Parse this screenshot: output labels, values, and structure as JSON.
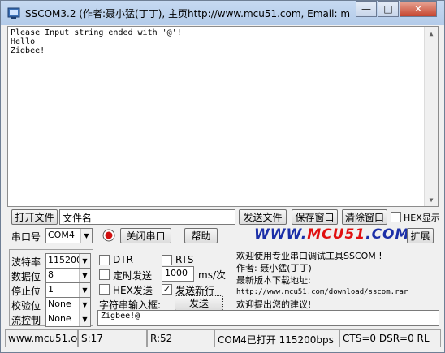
{
  "window": {
    "title": "SSCOM3.2 (作者:聂小猛(丁丁), 主页http://www.mcu51.com,  Email: mc...",
    "minimize": "—",
    "maximize": "□",
    "close": "✕"
  },
  "output": {
    "lines": [
      "Please Input string ended with '@'!",
      "Hello",
      "Zigbee!"
    ]
  },
  "toolbar": {
    "open_file": "打开文件",
    "file_name": "文件名",
    "send_file": "发送文件",
    "save_window": "保存窗口",
    "clear_window": "清除窗口",
    "hex_display": "HEX显示"
  },
  "port_row": {
    "port_label": "串口号",
    "port_value": "COM4",
    "close_port": "关闭串口",
    "help": "帮助",
    "expand": "扩展",
    "logo_prefix": "WWW.",
    "logo_main": "MCU51",
    "logo_suffix": ".COM"
  },
  "settings": {
    "baud_label": "波特率",
    "baud_value": "115200",
    "data_bits_label": "数据位",
    "data_bits_value": "8",
    "stop_bits_label": "停止位",
    "stop_bits_value": "1",
    "parity_label": "校验位",
    "parity_value": "None",
    "flow_label": "流控制",
    "flow_value": "None"
  },
  "options": {
    "dtr": "DTR",
    "rts": "RTS",
    "timed_send": "定时发送",
    "interval_value": "1000",
    "interval_unit": "ms/次",
    "hex_send": "HEX发送",
    "send_newline": "发送新行",
    "input_label": "字符串输入框:",
    "send_button": "发送",
    "send_newline_checked": true
  },
  "info": {
    "line1": "欢迎使用专业串口调试工具SSCOM !",
    "line2": "作者: 聂小猛(丁丁)",
    "line3": "最新版本下载地址:",
    "line4": "http://www.mcu51.com/download/sscom.rar",
    "line5": "欢迎提出您的建议!"
  },
  "input": {
    "value": "Zigbee!@"
  },
  "status": {
    "site": "www.mcu51.cor",
    "sent": "S:17",
    "received": "R:52",
    "port_state": "COM4已打开  115200bps",
    "signals": "CTS=0 DSR=0 RL"
  },
  "colors": {
    "titlebar": "#c6d9f1",
    "logo_blue": "#1b2fa8",
    "logo_red": "#e01010",
    "indicator_red": "#d01010"
  }
}
